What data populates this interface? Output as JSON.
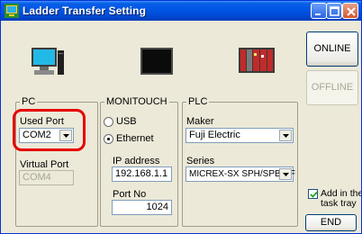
{
  "window": {
    "title": "Ladder Transfer Setting",
    "title_bar_color": "#0055e5",
    "app_icon": "ladder-transfer-icon",
    "controls": [
      "minimize-icon",
      "maximize-icon",
      "close-icon"
    ]
  },
  "devices": {
    "pc_icon": "pc-computer-icon",
    "monitouch_icon": "monitouch-display-icon",
    "plc_icon": "plc-module-icon"
  },
  "pc": {
    "group_title": "PC",
    "used_port_label": "Used Port",
    "used_port_value": "COM2",
    "virtual_port_label": "Virtual Port",
    "virtual_port_value": "COM4"
  },
  "monitouch": {
    "group_title": "MONITOUCH",
    "usb_label": "USB",
    "ethernet_label": "Ethernet",
    "selected": "Ethernet",
    "ip_label": "IP address",
    "ip_value": "192.168.1.1",
    "port_label": "Port No",
    "port_value": "1024"
  },
  "plc": {
    "group_title": "PLC",
    "maker_label": "Maker",
    "maker_value": "Fuji Electric",
    "series_label": "Series",
    "series_value": "MICREX-SX SPH/SPB CF"
  },
  "actions": {
    "online_label": "ONLINE",
    "offline_label": "OFFLINE",
    "tray_checkbox_label_line1": "Add in the",
    "tray_checkbox_label_line2": "task tray",
    "tray_checked": true,
    "end_label": "END"
  },
  "highlight_color": "#e60000"
}
